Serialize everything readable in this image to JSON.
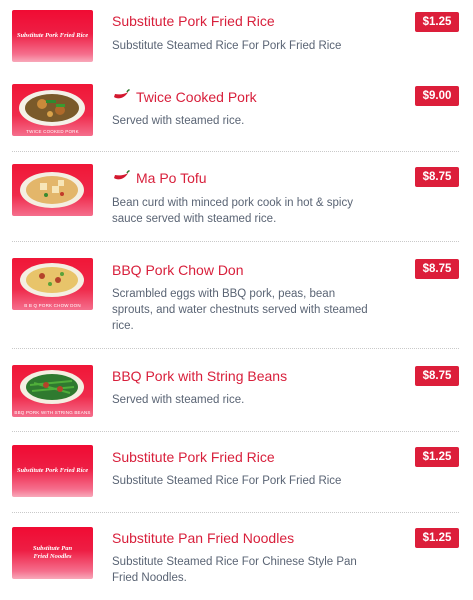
{
  "colors": {
    "title": "#d81f3b",
    "price_badge": "#dc1e3a",
    "description": "#5a6474",
    "thumbnail_red": "#f00b33"
  },
  "items": [
    {
      "title": "Substitute Pork Fried Rice",
      "description": "Substitute Steamed Rice For Pork Fried Rice",
      "price": "$1.25",
      "spicy": false,
      "thumbnail_text": "Substitute Pork Fried Rice"
    },
    {
      "title": "Twice Cooked Pork",
      "description": "Served with steamed rice.",
      "price": "$9.00",
      "spicy": true,
      "thumbnail_text": "TWICE COOKED PORK"
    },
    {
      "title": "Ma Po Tofu",
      "description": "Bean curd with minced pork cook in hot & spicy sauce served with steamed rice.",
      "price": "$8.75",
      "spicy": true,
      "thumbnail_text": ""
    },
    {
      "title": "BBQ Pork Chow Don",
      "description": "Scrambled eggs with BBQ pork, peas, bean sprouts, and water chestnuts served with steamed rice.",
      "price": "$8.75",
      "spicy": false,
      "thumbnail_text": "B B Q PORK CHOW DON"
    },
    {
      "title": "BBQ Pork with String Beans",
      "description": "Served with steamed rice.",
      "price": "$8.75",
      "spicy": false,
      "thumbnail_text": "BBQ PORK WITH STRING BEANS"
    },
    {
      "title": "Substitute Pork Fried Rice",
      "description": "Substitute Steamed Rice For Pork Fried Rice",
      "price": "$1.25",
      "spicy": false,
      "thumbnail_text": "Substitute Pork Fried Rice"
    },
    {
      "title": "Substitute Pan Fried Noodles",
      "description": "Substitute Steamed Rice For Chinese Style Pan Fried Noodles.",
      "price": "$1.25",
      "spicy": false,
      "thumbnail_text": "Substitute Pan Fried Noodles"
    }
  ],
  "icons": {
    "spicy": "chili-pepper-icon"
  }
}
